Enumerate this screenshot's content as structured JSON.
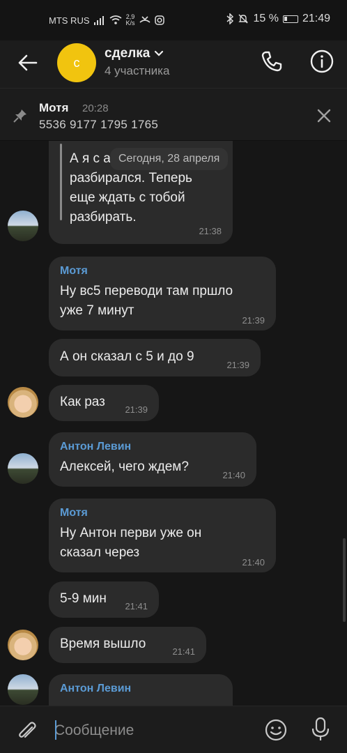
{
  "status_bar": {
    "carrier": "MTS RUS",
    "speed": "2,9",
    "speed_unit": "K/s",
    "battery_pct": "15 %",
    "clock": "21:49"
  },
  "header": {
    "avatar_letter": "с",
    "title": "сделка",
    "subtitle": "4 участника"
  },
  "pinned": {
    "author": "Мотя",
    "time": "20:28",
    "text": "5536 9177 1795 1765"
  },
  "chat": {
    "date_chip": "Сегодня, 28 апреля",
    "quoted": {
      "lines": [
        "А я с а",
        "разбирался. Теперь",
        "еще ждать с тобой",
        "разбирать."
      ],
      "time": "21:38"
    },
    "messages": [
      {
        "sender": "Мотя",
        "lines": [
          "Ну вс5 переводи там пршло",
          "уже 7 минут"
        ],
        "time": "21:39"
      },
      {
        "sender": "",
        "lines": [
          "А он сказал с 5 и до 9"
        ],
        "time": "21:39"
      },
      {
        "sender": "",
        "lines": [
          "Как раз"
        ],
        "time": "21:39"
      },
      {
        "sender": "Антон Левин",
        "lines": [
          "Алексей, чего ждем?"
        ],
        "time": "21:40"
      },
      {
        "sender": "Мотя",
        "lines": [
          "Ну Антон перви уже он",
          "сказал через"
        ],
        "time": "21:40"
      },
      {
        "sender": "",
        "lines": [
          "5-9 мин"
        ],
        "time": "21:41"
      },
      {
        "sender": "",
        "lines": [
          "Время вышло"
        ],
        "time": "21:41"
      },
      {
        "sender": "Антон Левин",
        "lines": [],
        "time": ""
      }
    ]
  },
  "composer": {
    "placeholder": "Сообщение"
  },
  "colors": {
    "background": "#161616",
    "bubble": "#2b2b2b",
    "sender_name": "#5b9bd5",
    "avatar_group": "#f1c40f"
  }
}
